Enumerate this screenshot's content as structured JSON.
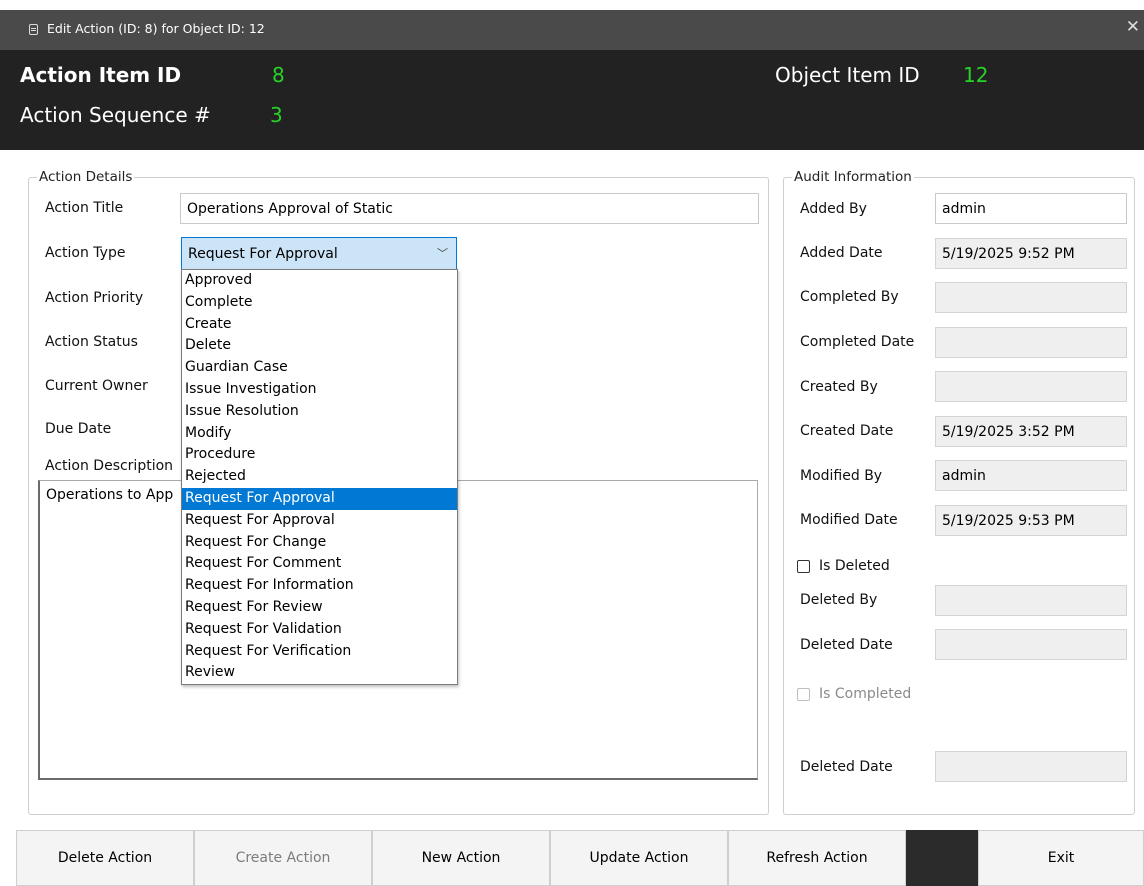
{
  "window": {
    "title": "Edit Action (ID: 8) for Object ID: 12",
    "close": "✕"
  },
  "header": {
    "action_item_label": "Action Item ID",
    "action_item_value": "8",
    "sequence_label": "Action Sequence #",
    "sequence_value": "3",
    "object_item_label": "Object Item ID",
    "object_item_value": "12"
  },
  "details": {
    "legend": "Action Details",
    "title_label": "Action Title",
    "title_value": "Operations Approval of Static",
    "type_label": "Action Type",
    "type_value": "Request For Approval",
    "priority_label": "Action Priority",
    "status_label": "Action Status",
    "owner_label": "Current Owner",
    "due_label": "Due Date",
    "description_label": "Action Description",
    "description_value": "Operations to App"
  },
  "type_options": [
    "Approved",
    "Complete",
    "Create",
    "Delete",
    "Guardian Case",
    "Issue Investigation",
    "Issue Resolution",
    "Modify",
    "Procedure",
    "Rejected",
    "Request For Approval",
    "Request For Approval",
    "Request For Change",
    "Request For Comment",
    "Request For Information",
    "Request For Review",
    "Request For Validation",
    "Request For Verification",
    "Review"
  ],
  "type_selected_index": 10,
  "audit": {
    "legend": "Audit Information",
    "added_by_label": "Added By",
    "added_by_value": "admin",
    "added_date_label": "Added Date",
    "added_date_value": "5/19/2025 9:52 PM",
    "completed_by_label": "Completed By",
    "completed_by_value": "",
    "completed_date_label": "Completed Date",
    "completed_date_value": "",
    "created_by_label": "Created By",
    "created_by_value": "",
    "created_date_label": "Created Date",
    "created_date_value": "5/19/2025 3:52 PM",
    "modified_by_label": "Modified By",
    "modified_by_value": "admin",
    "modified_date_label": "Modified Date",
    "modified_date_value": "5/19/2025 9:53 PM",
    "is_deleted_label": "Is Deleted",
    "deleted_by_label": "Deleted By",
    "deleted_by_value": "",
    "deleted_date_label": "Deleted Date",
    "deleted_date_value": "",
    "is_completed_label": "Is Completed",
    "deleted_date2_label": "Deleted Date",
    "deleted_date2_value": ""
  },
  "buttons": {
    "delete": "Delete Action",
    "create": "Create Action",
    "new": "New Action",
    "update": "Update Action",
    "refresh": "Refresh Action",
    "exit": "Exit"
  },
  "colors": {
    "header_bg": "#222222",
    "accent_value": "#27d227",
    "selection": "#0078d4"
  }
}
